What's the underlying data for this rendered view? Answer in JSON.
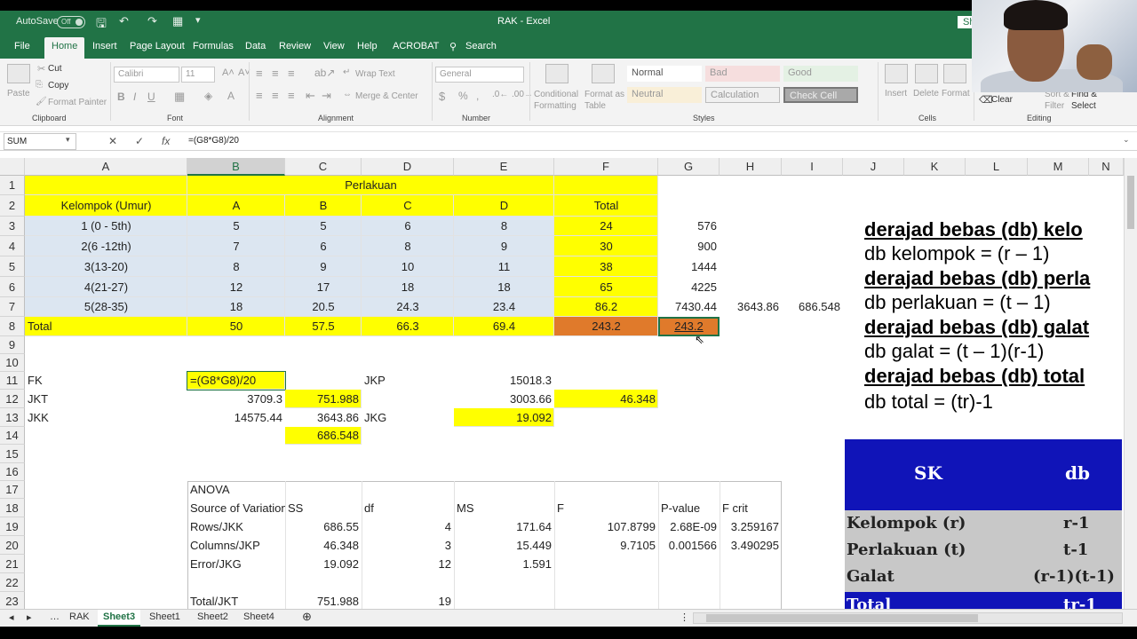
{
  "titlebar": {
    "autosave": "AutoSave",
    "autosave_state": "Off",
    "title": "RAK - Excel",
    "share": "Sh"
  },
  "tabs": [
    "File",
    "Home",
    "Insert",
    "Page Layout",
    "Formulas",
    "Data",
    "Review",
    "View",
    "Help",
    "ACROBAT"
  ],
  "search": "Search",
  "ribbon": {
    "paste": "Paste",
    "cut": "Cut",
    "copy": "Copy",
    "format_painter": "Format Painter",
    "clipboard": "Clipboard",
    "font_name": "Calibri",
    "font_size": "11",
    "font": "Font",
    "wrap_text": "Wrap Text",
    "merge_center": "Merge & Center",
    "alignment": "Alignment",
    "number_format": "General",
    "number": "Number",
    "conditional_formatting": "Conditional Formatting",
    "format_as_table": "Format as Table",
    "styles": {
      "normal": "Normal",
      "bad": "Bad",
      "good": "Good",
      "neutral": "Neutral",
      "calculation": "Calculation",
      "check_cell": "Check Cell",
      "label": "Styles"
    },
    "insert": "Insert",
    "delete": "Delete",
    "format": "Format",
    "cells": "Cells",
    "clear": "Clear",
    "sort_filter": "Sort & Filter",
    "find_select": "Find & Select",
    "editing": "Editing"
  },
  "formula_bar": {
    "name_box": "SUM",
    "cancel": "✕",
    "enter": "✓",
    "fx": "fx",
    "formula": "=(G8*G8)/20"
  },
  "columns": [
    "A",
    "B",
    "C",
    "D",
    "E",
    "F",
    "G",
    "H",
    "I",
    "J",
    "K",
    "L",
    "M",
    "N"
  ],
  "rows": [
    "1",
    "2",
    "3",
    "4",
    "5",
    "6",
    "7",
    "8",
    "9",
    "10",
    "11",
    "12",
    "13",
    "14",
    "15",
    "16",
    "17",
    "18",
    "19",
    "20",
    "21",
    "22",
    "23"
  ],
  "cells": {
    "B1": "Perlakuan",
    "A2": "Kelompok (Umur)",
    "B2": "A",
    "C2": "B",
    "D2": "C",
    "E2": "D",
    "F2": "Total",
    "A3": "1 (0 - 5th)",
    "B3": "5",
    "C3": "5",
    "D3": "6",
    "E3": "8",
    "F3": "24",
    "G3": "576",
    "A4": "2(6 -12th)",
    "B4": "7",
    "C4": "6",
    "D4": "8",
    "E4": "9",
    "F4": "30",
    "G4": "900",
    "A5": "3(13-20)",
    "B5": "8",
    "C5": "9",
    "D5": "10",
    "E5": "11",
    "F5": "38",
    "G5": "1444",
    "A6": "4(21-27)",
    "B6": "12",
    "C6": "17",
    "D6": "18",
    "E6": "18",
    "F6": "65",
    "G6": "4225",
    "A7": "5(28-35)",
    "B7": "18",
    "C7": "20.5",
    "D7": "24.3",
    "E7": "23.4",
    "F7": "86.2",
    "G7": "7430.44",
    "H7": "3643.86",
    "I7": "686.548",
    "A8": "Total",
    "B8": "50",
    "C8": "57.5",
    "D8": "66.3",
    "E8": "69.4",
    "F8": "243.2",
    "G8": "243.2",
    "A11": "FK",
    "B11": "=(G8*G8)/20",
    "D11": "JKP",
    "E11": "15018.3",
    "A12": "JKT",
    "B12": "3709.3",
    "C12": "751.988",
    "E12": "3003.66",
    "F12": "46.348",
    "A13": "JKK",
    "B13": "14575.44",
    "C13": "3643.86",
    "D13": "JKG",
    "E13": "19.092",
    "C14": "686.548",
    "B17": "ANOVA",
    "B18": "Source of Variation",
    "C18": "SS",
    "D18": "df",
    "E18": "MS",
    "F18": "F",
    "G18": "P-value",
    "H18": "F crit",
    "B19": "Rows/JKK",
    "C19": "686.55",
    "D19": "4",
    "E19": "171.64",
    "F19": "107.8799",
    "G19": "2.68E-09",
    "H19": "3.259167",
    "B20": "Columns/JKP",
    "C20": "46.348",
    "D20": "3",
    "E20": "15.449",
    "F20": "9.7105",
    "G20": "0.001566",
    "H20": "3.490295",
    "B21": "Error/JKG",
    "C21": "19.092",
    "D21": "12",
    "E21": "1.591",
    "B23": "Total/JKT",
    "C23": "751.988",
    "D23": "19"
  },
  "overlay": {
    "l1": "derajad bebas (db) kelo",
    "l2": "db kelompok = (r – 1)",
    "l3": "derajad bebas (db) perla",
    "l4": "db perlakuan = (t – 1)",
    "l5": "derajad bebas (db) galat",
    "l6": "db galat = (t – 1)(r-1)",
    "l7": "derajad bebas (db) total",
    "l8": "db total = (tr)-1"
  },
  "anova_image": {
    "head_sk": "SK",
    "head_db": "db",
    "rows": [
      {
        "sk": "Kelompok (r)",
        "db": "r-1"
      },
      {
        "sk": "Perlakuan (t)",
        "db": "t-1"
      },
      {
        "sk": "Galat",
        "db": "(r-1)(t-1)"
      },
      {
        "sk": "Total",
        "db": "tr-1"
      }
    ]
  },
  "sheets": [
    "RAK",
    "Sheet3",
    "Sheet1",
    "Sheet2",
    "Sheet4"
  ],
  "active_sheet": "Sheet3",
  "colors": {
    "excel_green": "#217346",
    "yellow": "#ffff00",
    "orange": "#e07a2b",
    "light_blue": "#dce6f1"
  }
}
